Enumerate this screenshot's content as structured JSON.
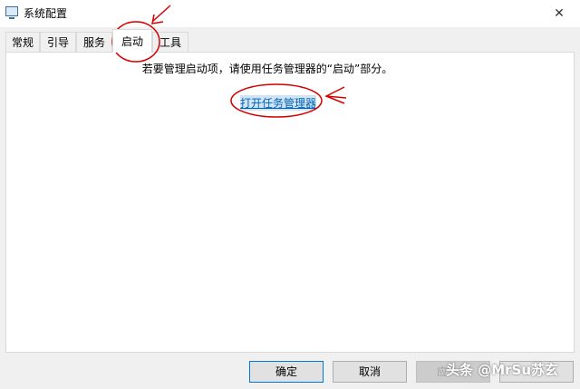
{
  "window": {
    "title": "系统配置",
    "app_icon": "system-config-icon",
    "close_icon": "close-icon",
    "close_glyph": "✕"
  },
  "tabs": [
    {
      "label": "常规"
    },
    {
      "label": "引导"
    },
    {
      "label": "服务"
    },
    {
      "label": "启动",
      "active": true
    },
    {
      "label": "工具"
    }
  ],
  "startup": {
    "info_text": "若要管理启动项，请使用任务管理器的“启动”部分。",
    "link_text": "打开任务管理器"
  },
  "buttons": {
    "ok": "确定",
    "cancel": "取消",
    "apply": "应",
    "help": "帮助"
  },
  "watermark": "头条 @MrSu苏玄",
  "colors": {
    "link": "#0063b1",
    "annotation": "#d40000",
    "focus": "#0078d7"
  }
}
